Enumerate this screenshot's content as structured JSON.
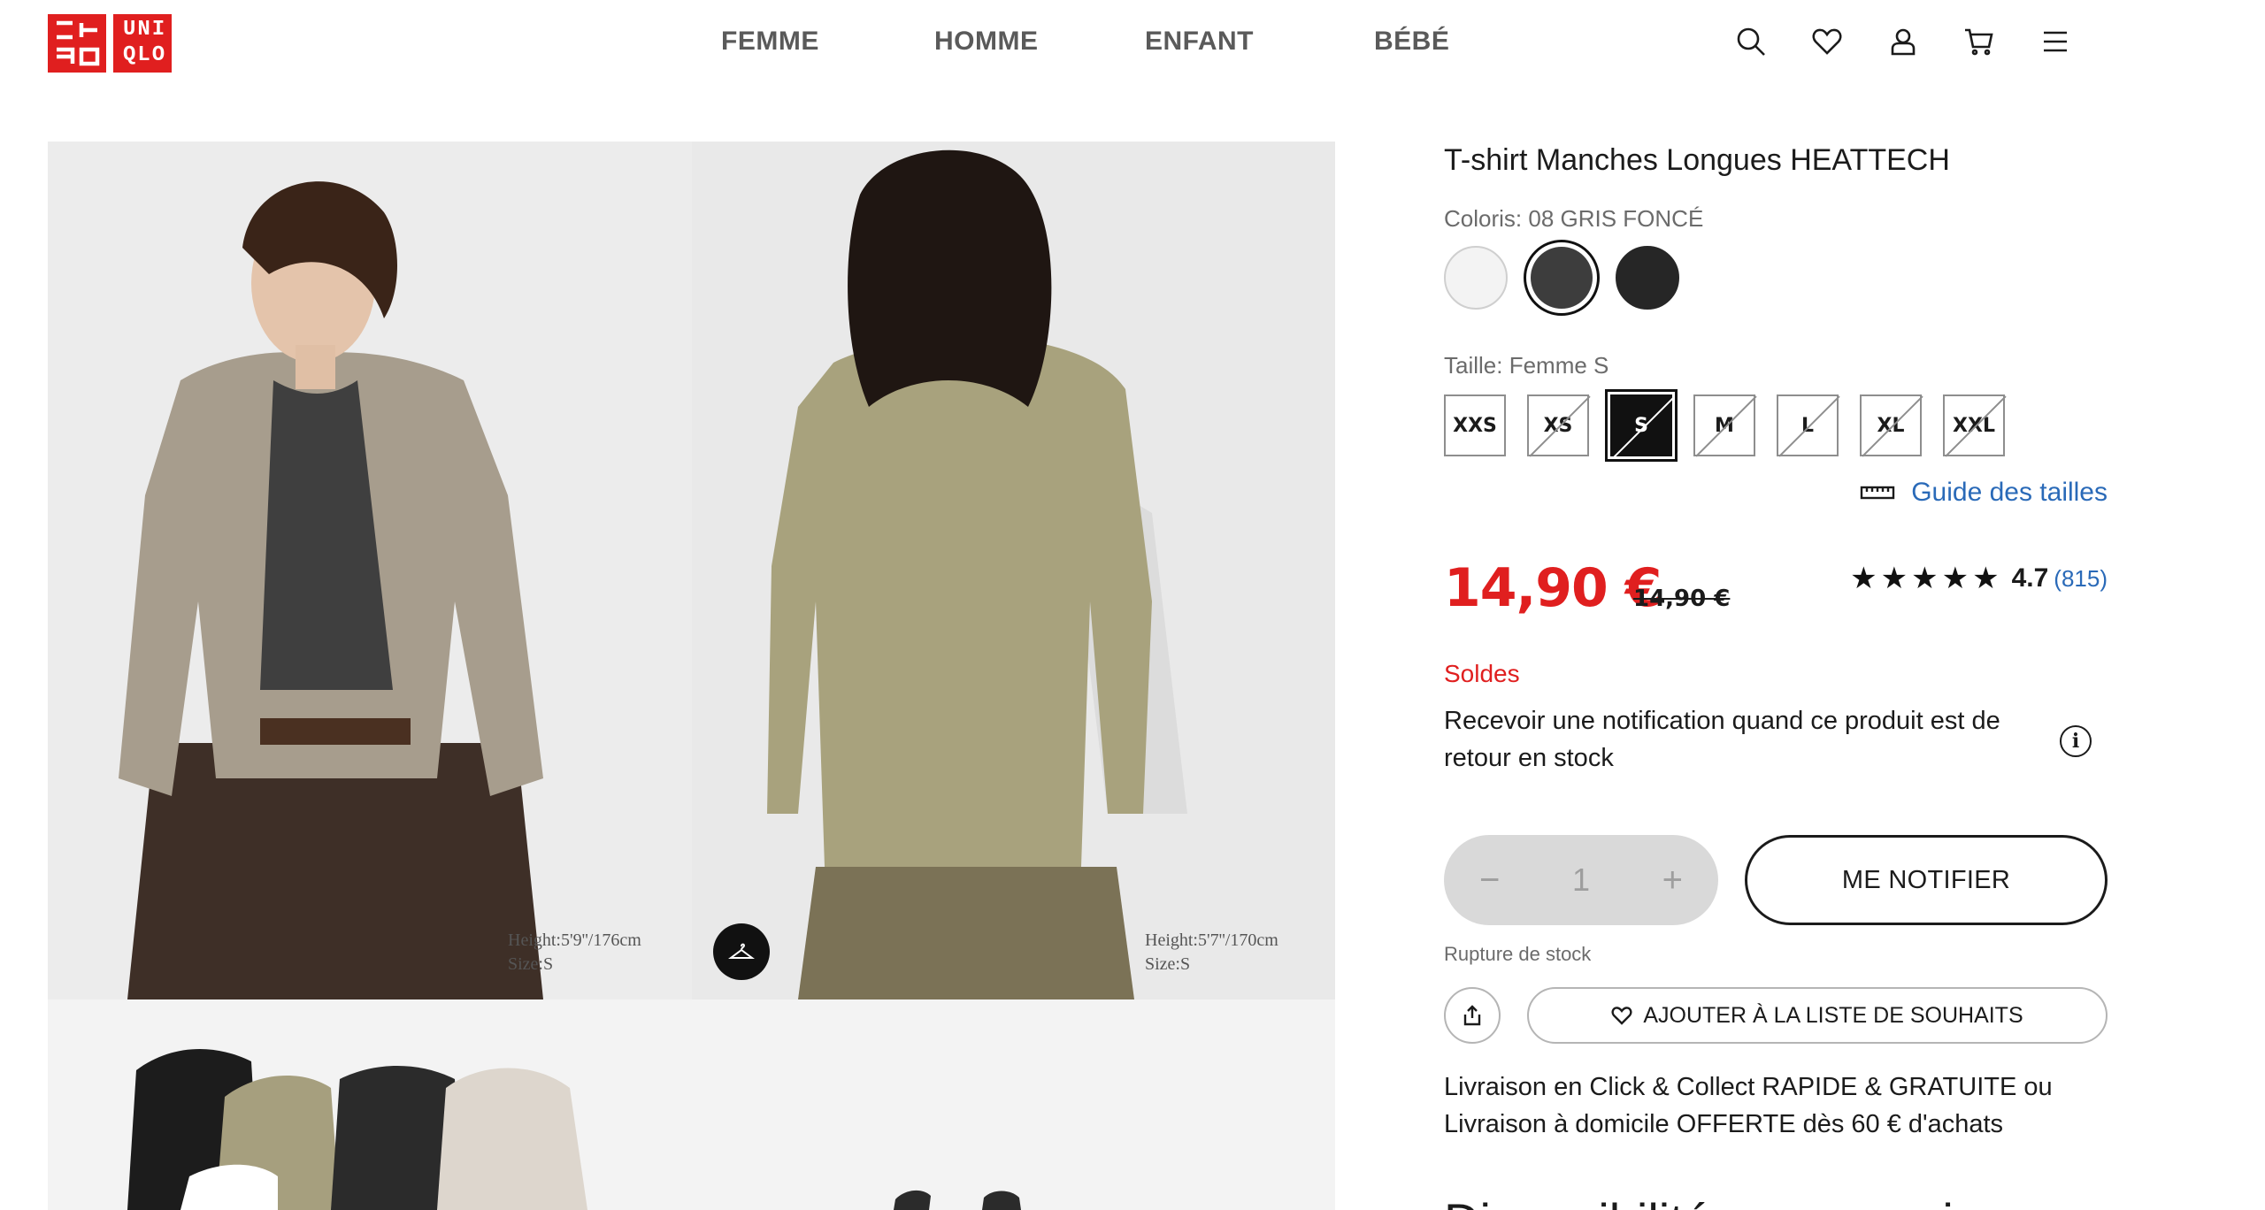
{
  "header": {
    "logo_top": "UNI",
    "logo_bottom": "QLO",
    "nav": [
      "FEMME",
      "HOMME",
      "ENFANT",
      "BÉBÉ"
    ],
    "icons": [
      "search-icon",
      "heart-icon",
      "user-icon",
      "cart-icon",
      "menu-icon"
    ]
  },
  "gallery": {
    "photo1_caption_height": "Height:5'9''/176cm",
    "photo1_caption_size": "Size:S",
    "photo2_caption_height": "Height:5'7''/170cm",
    "photo2_caption_size": "Size:S"
  },
  "product": {
    "title": "T-shirt Manches Longues HEATTECH",
    "color_label": "Coloris: 08 GRIS FONCÉ",
    "colors": [
      {
        "name": "white",
        "hex": "#f3f3f3",
        "selected": false
      },
      {
        "name": "dark-grey",
        "hex": "#3d3d3d",
        "selected": true
      },
      {
        "name": "black",
        "hex": "#262626",
        "selected": false
      }
    ],
    "size_label": "Taille: Femme S",
    "sizes": [
      "XXS",
      "XS",
      "S",
      "M",
      "L",
      "XL",
      "XXL"
    ],
    "size_guide": "Guide des tailles",
    "price": "14,90 €",
    "old_price": "14,90 €",
    "stars": "★★★★★",
    "rating_value": "4.7",
    "rating_count": "(815)",
    "sale_label": "Soldes",
    "notify_text": "Recevoir une notification quand ce produit est de retour en stock",
    "quantity": "1",
    "qty_minus": "−",
    "qty_plus": "+",
    "notify_button": "ME NOTIFIER",
    "out_of_stock": "Rupture de stock",
    "wishlist_button": "AJOUTER À LA LISTE DE SOUHAITS",
    "delivery_text": "Livraison en Click & Collect RAPIDE & GRATUITE ou Livraison à domicile OFFERTE dès 60 € d'achats",
    "availability_heading": "Disponibilité en magasin"
  },
  "colors": {
    "brand_red": "#e01f1f",
    "link_blue": "#2a6ab8"
  }
}
